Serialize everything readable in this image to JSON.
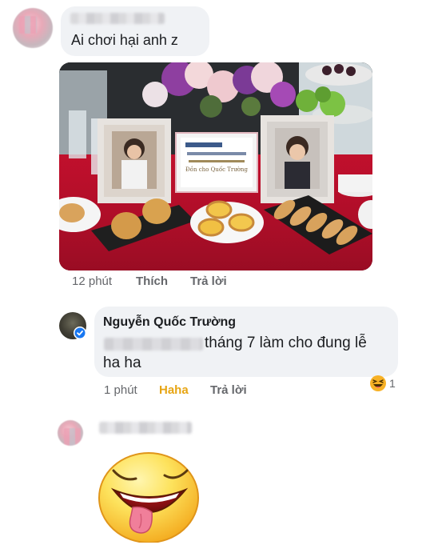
{
  "comment1": {
    "text": "Ai chơi hại anh z",
    "time": "12 phút",
    "like_label": "Thích",
    "reply_label": "Trả lời"
  },
  "photo": {
    "certificate_line": "Đồn cho Quốc Trường",
    "description": "memorial table photo"
  },
  "comment2": {
    "author": "Nguyễn Quốc Trường",
    "text_line1": "tháng 7 làm cho đung lễ",
    "text_line2": "ha ha",
    "time": "1 phút",
    "reaction_label": "Haha",
    "reply_label": "Trả lời",
    "reaction_count": "1",
    "reaction_color": "#f7b125",
    "verified_color": "#1877f2"
  },
  "comment3": {
    "sticker": "tongue-out-emoji-sticker"
  }
}
